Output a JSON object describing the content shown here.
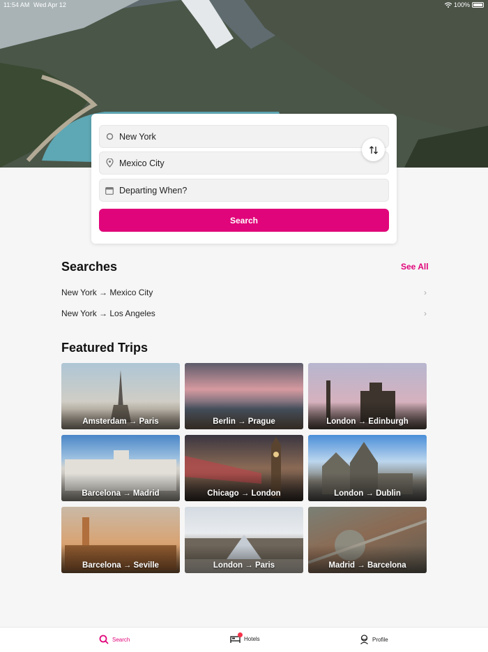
{
  "status": {
    "time": "11:54 AM",
    "date": "Wed Apr 12",
    "battery": "100%"
  },
  "search_form": {
    "origin": "New York",
    "destination": "Mexico City",
    "date_placeholder": "Departing When?",
    "submit_label": "Search"
  },
  "searches": {
    "title": "Searches",
    "see_all": "See All",
    "items": [
      "New York → Mexico City",
      "New York → Los Angeles"
    ]
  },
  "featured": {
    "title": "Featured Trips",
    "trips": [
      "Amsterdam → Paris",
      "Berlin → Prague",
      "London → Edinburgh",
      "Barcelona → Madrid",
      "Chicago → London",
      "London → Dublin",
      "Barcelona → Seville",
      "London → Paris",
      "Madrid → Barcelona"
    ]
  },
  "tabs": {
    "search": "Search",
    "hotels": "Hotels",
    "profile": "Profile"
  },
  "colors": {
    "accent": "#e0057a",
    "badge": "#f5334a"
  }
}
